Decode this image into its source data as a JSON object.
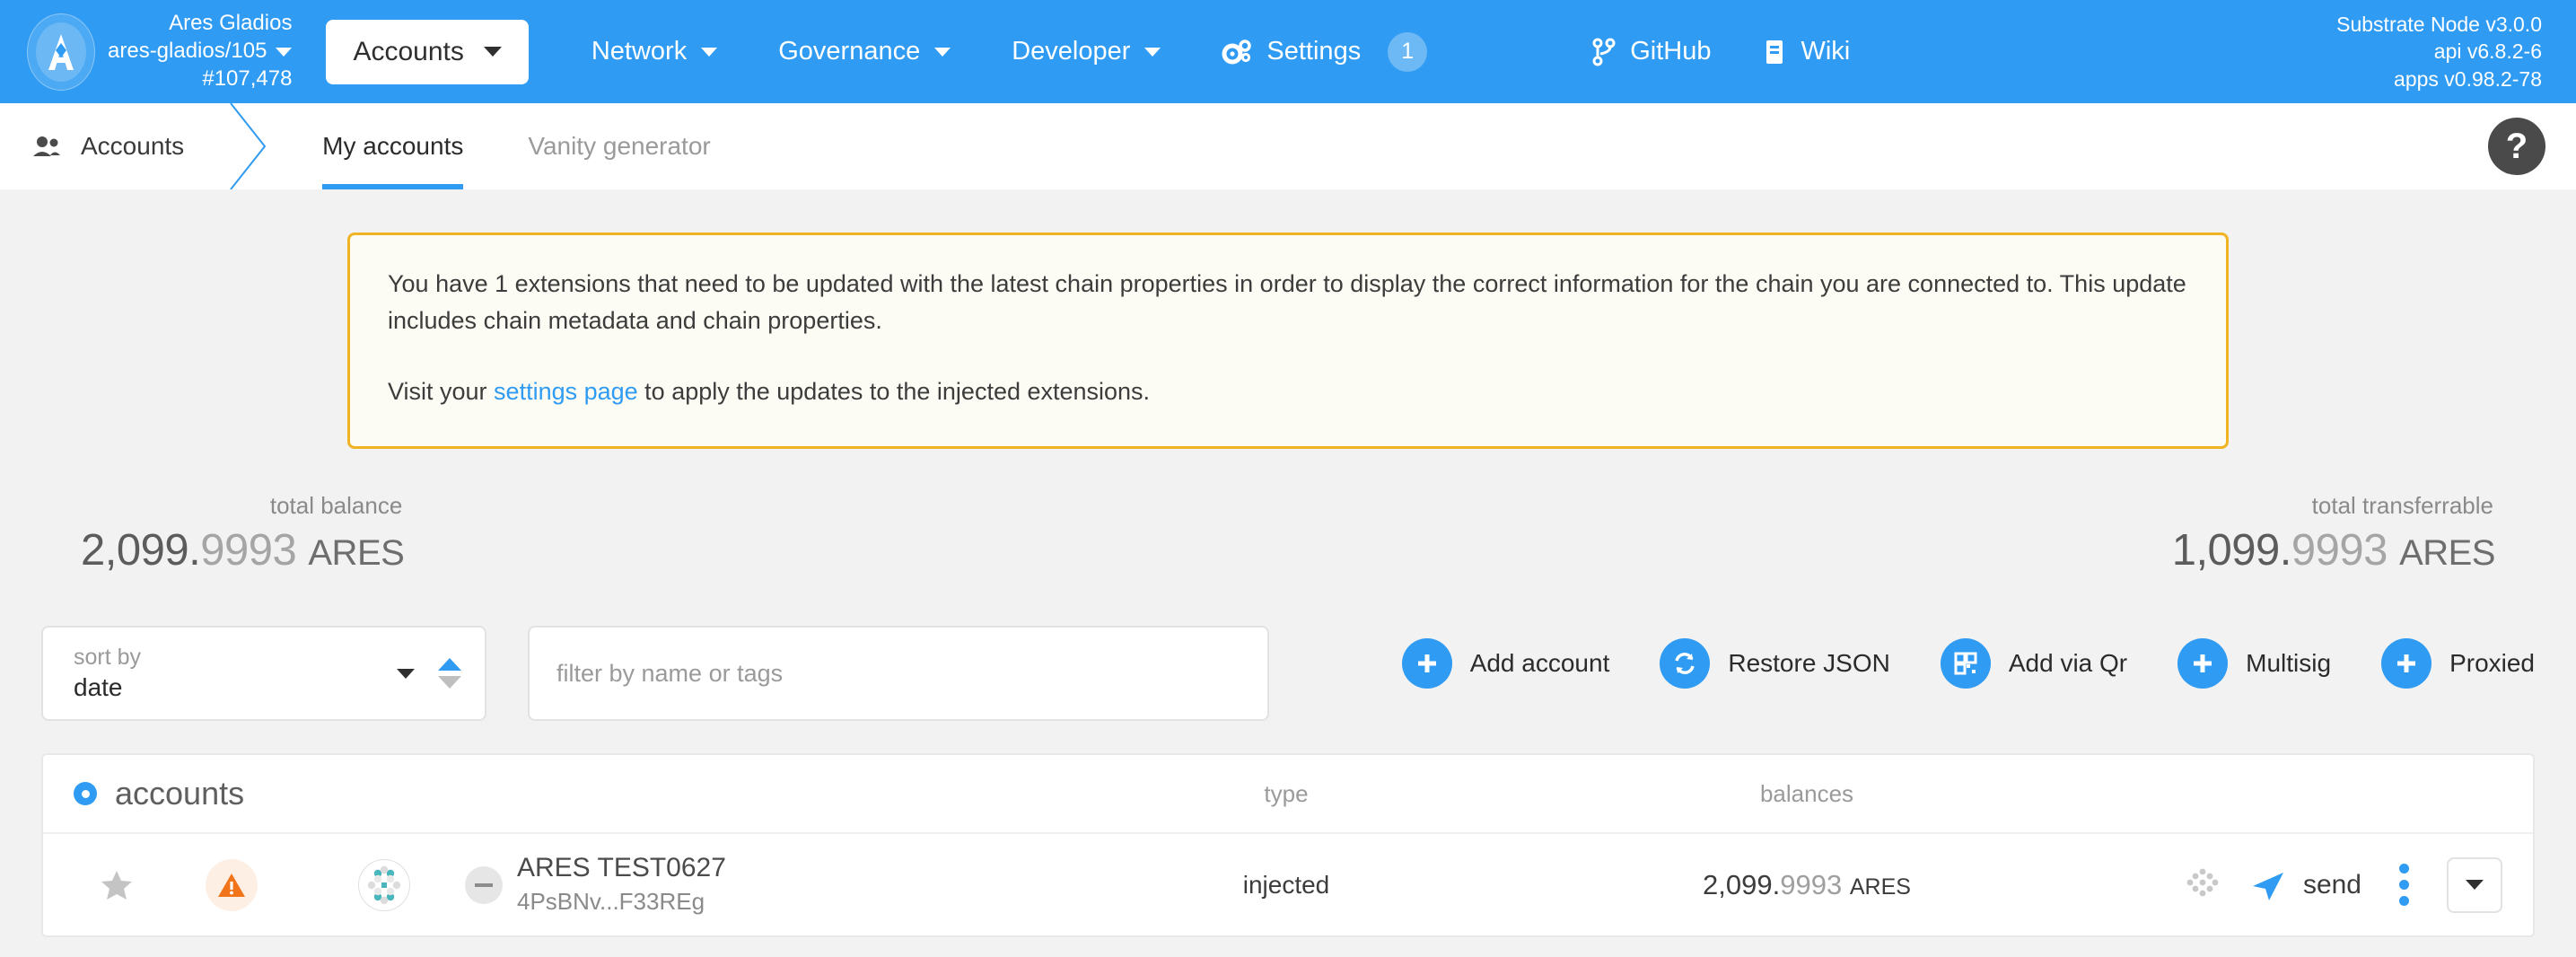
{
  "header": {
    "chain_name": "Ares Gladios",
    "chain_path": "ares-gladios/105",
    "block_number": "#107,478",
    "accounts_dropdown": "Accounts",
    "nav": [
      {
        "label": "Network"
      },
      {
        "label": "Governance"
      },
      {
        "label": "Developer"
      },
      {
        "label": "Settings",
        "badge": "1"
      }
    ],
    "links": [
      {
        "label": "GitHub",
        "icon": "github-icon"
      },
      {
        "label": "Wiki",
        "icon": "book-icon"
      }
    ],
    "versions": {
      "node": "Substrate Node v3.0.0",
      "api": "api v6.8.2-6",
      "apps": "apps v0.98.2-78"
    }
  },
  "subnav": {
    "section": "Accounts",
    "tabs": [
      {
        "label": "My accounts",
        "active": true
      },
      {
        "label": "Vanity generator",
        "active": false
      }
    ],
    "help": "?"
  },
  "banner": {
    "line1": "You have 1 extensions that need to be updated with the latest chain properties in order to display the correct information for the chain you are connected to. This update includes chain metadata and chain properties.",
    "line2_before": "Visit your ",
    "link": "settings page",
    "line2_after": " to apply the updates to the injected extensions."
  },
  "totals": {
    "balance_label": "total balance",
    "balance_int": "2,099.",
    "balance_dec": "9993",
    "balance_unit": "ARES",
    "transferrable_label": "total transferrable",
    "transferrable_int": "1,099.",
    "transferrable_dec": "9993",
    "transferrable_unit": "ARES"
  },
  "controls": {
    "sort_label": "sort by",
    "sort_value": "date",
    "filter_placeholder": "filter by name or tags",
    "actions": [
      {
        "label": "Add account",
        "icon": "plus-icon"
      },
      {
        "label": "Restore JSON",
        "icon": "sync-icon"
      },
      {
        "label": "Add via Qr",
        "icon": "qr-icon"
      },
      {
        "label": "Multisig",
        "icon": "plus-icon"
      },
      {
        "label": "Proxied",
        "icon": "plus-icon"
      }
    ]
  },
  "table": {
    "title": "accounts",
    "col_type": "type",
    "col_balances": "balances",
    "rows": [
      {
        "name": "ARES TEST0627",
        "address": "4PsBNv...F33REg",
        "type": "injected",
        "balance_int": "2,099.",
        "balance_dec": "9993",
        "balance_unit": "ARES",
        "send_label": "send"
      }
    ]
  }
}
